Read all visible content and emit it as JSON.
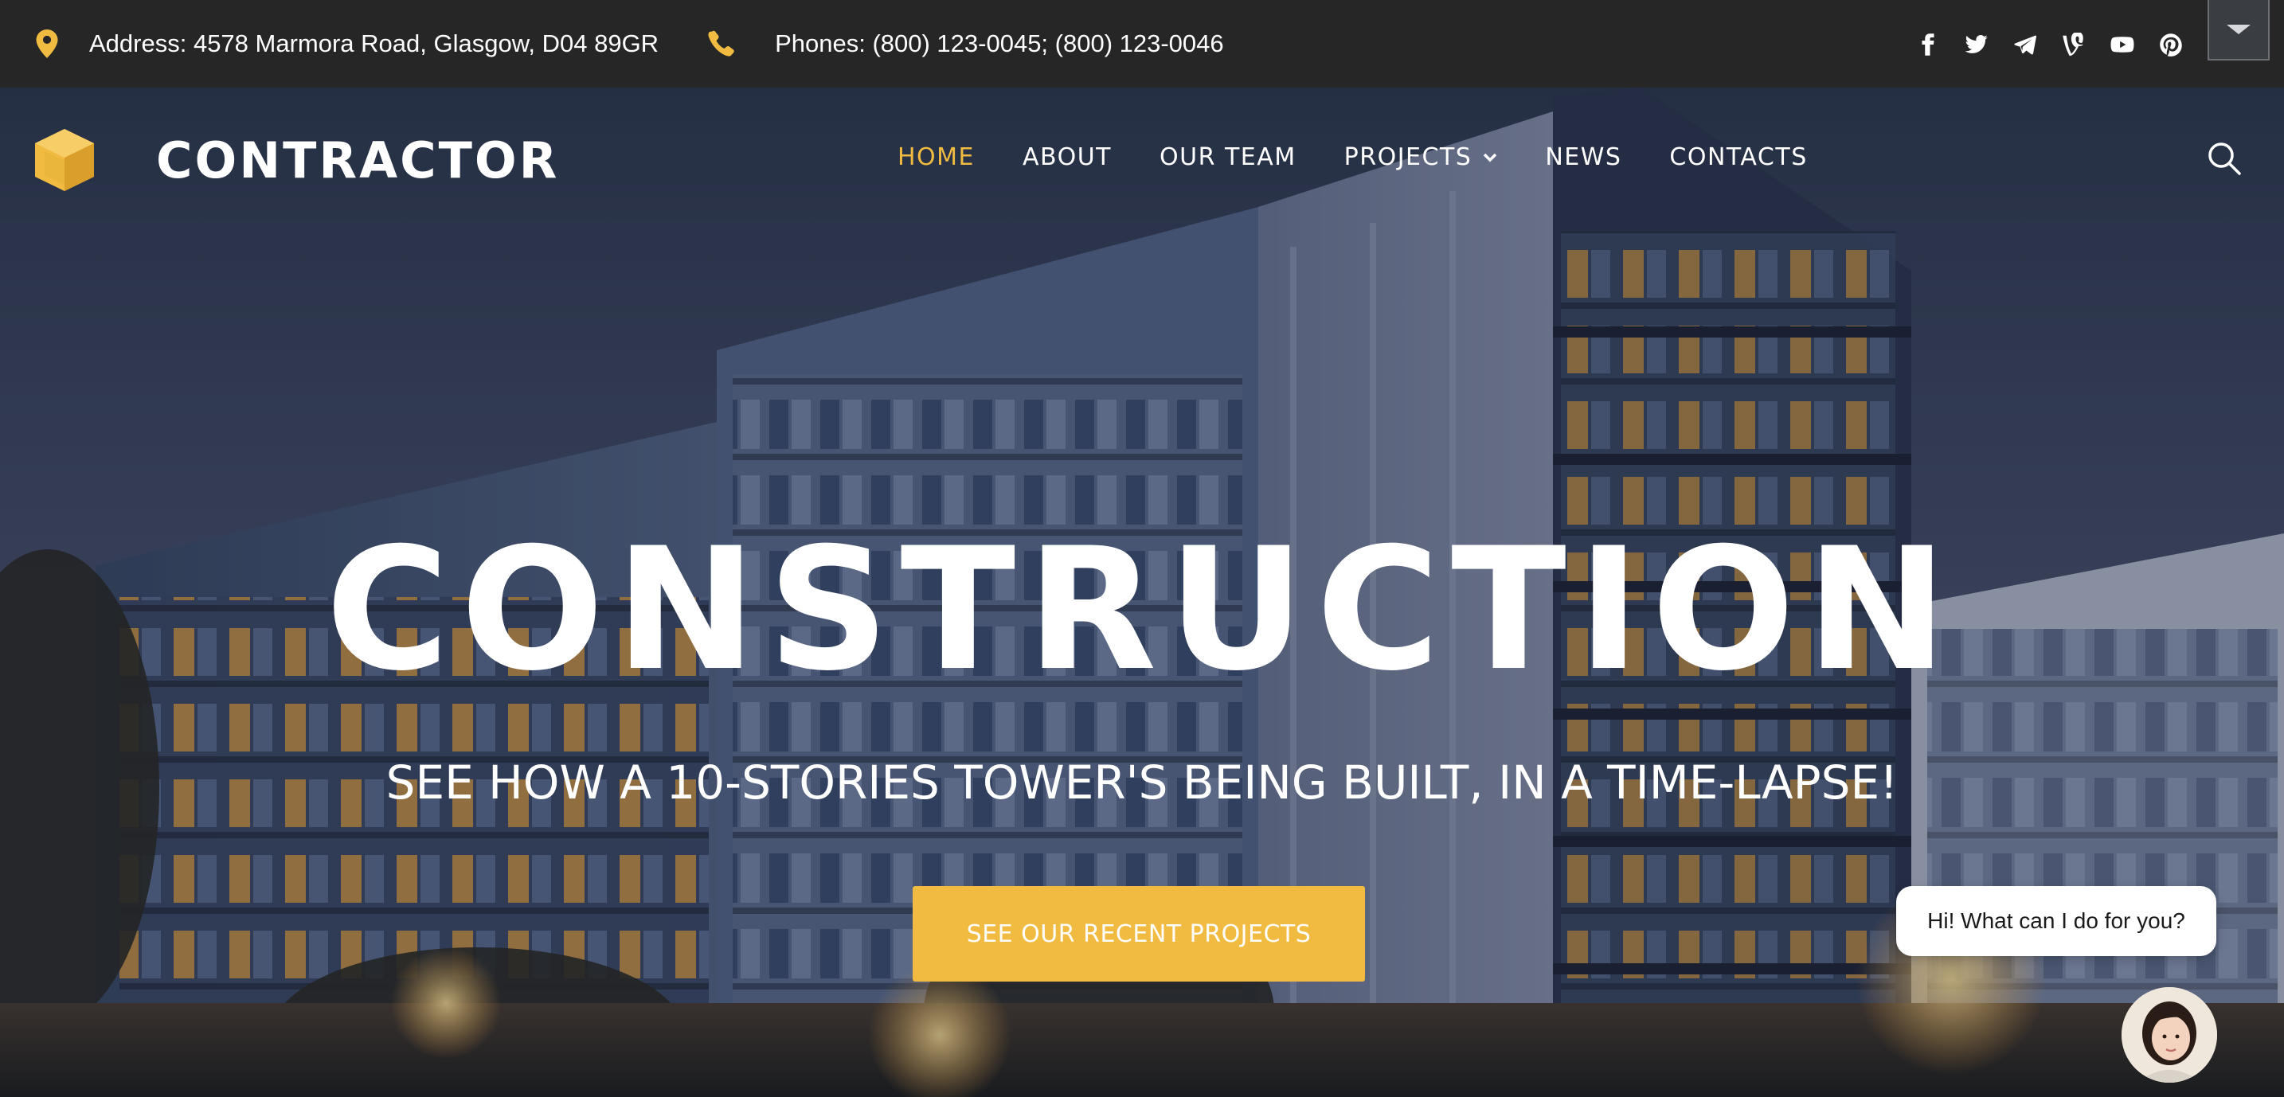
{
  "topbar": {
    "address": "Address: 4578 Marmora Road, Glasgow, D04 89GR",
    "phones": "Phones: (800) 123-0045; (800) 123-0046",
    "socials": [
      "facebook-icon",
      "twitter-icon",
      "telegram-icon",
      "vine-icon",
      "youtube-icon",
      "pinterest-icon"
    ]
  },
  "header": {
    "brand": "CONTRACTOR",
    "nav": [
      {
        "label": "HOME",
        "active": true
      },
      {
        "label": "ABOUT"
      },
      {
        "label": "OUR TEAM"
      },
      {
        "label": "PROJECTS",
        "has_dropdown": true
      },
      {
        "label": "NEWS"
      },
      {
        "label": "CONTACTS"
      }
    ]
  },
  "hero": {
    "title": "CONSTRUCTION",
    "subtitle": "SEE HOW A 10-STORIES TOWER'S BEING BUILT, IN A TIME-LAPSE!",
    "cta_label": "SEE OUR RECENT PROJECTS"
  },
  "chat": {
    "greeting": "Hi! What can I do for you?"
  },
  "colors": {
    "accent": "#f0bb40",
    "topbar_bg": "#262626",
    "text": "#ffffff"
  }
}
